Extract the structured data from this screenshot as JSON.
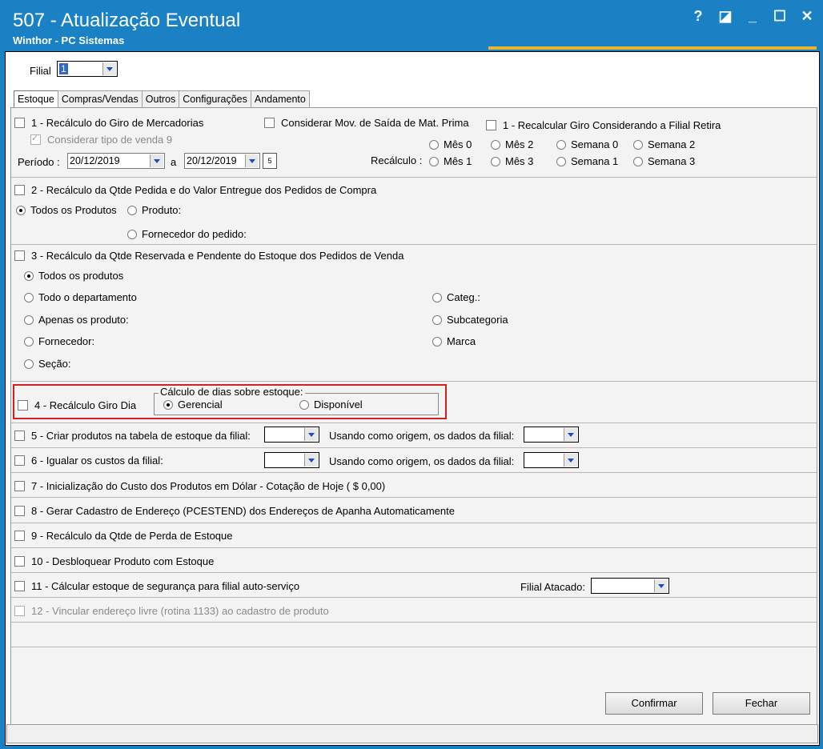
{
  "window": {
    "title": "507 - Atualização Eventual",
    "subtitle": "Winthor - PC Sistemas",
    "controls": {
      "help": "?",
      "restore": "◪",
      "minimize": "_",
      "maximize": "☐",
      "close": "✕"
    }
  },
  "filial": {
    "label": "Filial",
    "value": "1"
  },
  "tabs": [
    "Estoque",
    "Compras/Vendas",
    "Outros",
    "Configurações",
    "Andamento"
  ],
  "section1": {
    "label": "1 - Recálculo do Giro de Mercadorias",
    "consider_mov": "Considerar Mov. de Saída de Mat. Prima",
    "recalc_filial": "1 - Recalcular Giro Considerando a Filial Retira",
    "tipo_venda": "Considerar tipo de venda 9",
    "periodo_label": "Período :",
    "date_from": "20/12/2019",
    "a_label": "a",
    "date_to": "20/12/2019",
    "recalculo_label": "Recálculo :",
    "options": [
      "Mês 0",
      "Mês 2",
      "Semana 0",
      "Semana 2",
      "Mês 1",
      "Mês 3",
      "Semana 1",
      "Semana 3"
    ]
  },
  "section2": {
    "label": "2 - Recálculo da Qtde Pedida e do Valor Entregue dos Pedidos de Compra",
    "todos": "Todos os Produtos",
    "produto": "Produto:",
    "fornecedor": "Fornecedor do pedido:"
  },
  "section3": {
    "label": "3 - Recálculo da Qtde Reservada e Pendente do Estoque dos Pedidos de Venda",
    "todos": "Todos os produtos",
    "departamento": "Todo o departamento",
    "apenas": "Apenas os produto:",
    "fornecedor": "Fornecedor:",
    "secao": "Seção:",
    "categ": "Categ.:",
    "subcategoria": "Subcategoria",
    "marca": "Marca"
  },
  "section4": {
    "label": "4 - Recálculo Giro Dia",
    "group_label": "Cálculo de dias sobre estoque:",
    "gerencial": "Gerencial",
    "disponivel": "Disponível",
    "highlight_color": "#d42020"
  },
  "section5": {
    "label": "5 - Criar produtos na tabela de estoque da filial:",
    "origem": "Usando como origem, os dados da filial:"
  },
  "section6": {
    "label": "6 - Igualar os custos da filial:",
    "origem": "Usando como origem, os dados da filial:"
  },
  "section7": {
    "label": "7 - Inicialização do Custo dos Produtos em Dólar - Cotação de Hoje ( $ 0,00)"
  },
  "section8": {
    "label": "8 - Gerar Cadastro de Endereço (PCESTEND) dos Endereços de Apanha Automaticamente"
  },
  "section9": {
    "label": "9 - Recálculo da Qtde de Perda de Estoque"
  },
  "section10": {
    "label": "10 - Desbloquear Produto com Estoque"
  },
  "section11": {
    "label": "11 - Cálcular estoque de segurança para filial auto-serviço",
    "filial_atacado": "Filial Atacado:"
  },
  "section12": {
    "label": "12 - Vincular endereço livre (rotina 1133) ao cadastro de produto"
  },
  "buttons": {
    "confirmar": "Confirmar",
    "fechar": "Fechar"
  },
  "colors": {
    "title_bar": "#1a82c4",
    "accent_stripe": "#e9b530",
    "panel": "#f3f3f3"
  }
}
